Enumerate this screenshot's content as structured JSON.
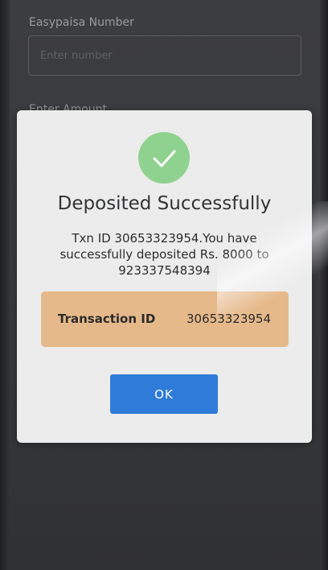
{
  "background": {
    "number_label": "Easypaisa Number",
    "number_placeholder": "Enter number",
    "amount_label": "Enter Amount"
  },
  "dialog": {
    "icon": "check-icon",
    "title": "Deposited Successfully",
    "message_line1": "Txn ID 30653323954.You have",
    "message_line2": "successfully deposited Rs. 8000 to",
    "message_line3": "923337548394",
    "transaction_label": "Transaction ID",
    "transaction_value": "30653323954",
    "ok_label": "OK"
  },
  "colors": {
    "success_green": "#8fd28f",
    "highlight_orange": "#e6b98a",
    "button_blue": "#2f7bd9"
  }
}
